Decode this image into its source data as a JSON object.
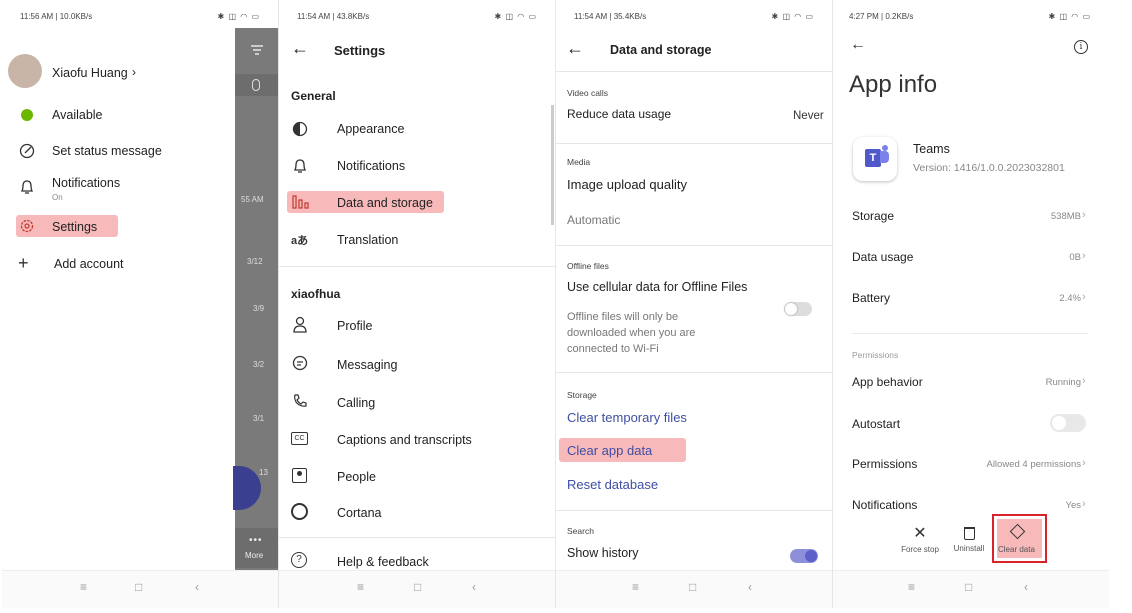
{
  "panel1": {
    "status_time": "11:56 AM | 10.0KB/s",
    "status_icons": "✱ ◫ ◠ ▭",
    "user_name": "Xiaofu Huang",
    "menu": [
      {
        "label": "Available",
        "sub": ""
      },
      {
        "label": "Set status message",
        "sub": ""
      },
      {
        "label": "Notifications",
        "sub": "On"
      },
      {
        "label": "Settings",
        "sub": ""
      },
      {
        "label": "Add account",
        "sub": ""
      }
    ],
    "overlay_times": [
      "55 AM",
      "3/12",
      "3/9",
      "3/2",
      "3/1",
      "13"
    ],
    "overlay_more": "More"
  },
  "panel2": {
    "status_time": "11:54 AM | 43.8KB/s",
    "status_icons": "✱ ◫ ◠ ▭",
    "title": "Settings",
    "section_general": "General",
    "general_items": [
      "Appearance",
      "Notifications",
      "Data and storage",
      "Translation"
    ],
    "section_account": "xiaofhua",
    "account_items": [
      "Profile",
      "Messaging",
      "Calling",
      "Captions and transcripts",
      "People",
      "Cortana",
      "Help & feedback"
    ]
  },
  "panel3": {
    "status_time": "11:54 AM | 35.4KB/s",
    "status_icons": "✱ ◫ ◠ ▭",
    "title": "Data and storage",
    "video_calls_header": "Video calls",
    "reduce_data_label": "Reduce data usage",
    "reduce_data_value": "Never",
    "media_header": "Media",
    "image_quality_label": "Image upload quality",
    "image_quality_value": "Automatic",
    "offline_header": "Offline files",
    "offline_label": "Use cellular data for Offline Files",
    "offline_desc": "Offline files will only be downloaded when you are connected to Wi-Fi",
    "storage_header": "Storage",
    "clear_temp": "Clear temporary files",
    "clear_app": "Clear app data",
    "reset_db": "Reset database",
    "search_header": "Search",
    "show_history": "Show history"
  },
  "panel4": {
    "status_time": "4:27 PM | 0.2KB/s",
    "status_icons": "✱ ◫ ◠ ▭",
    "title": "App info",
    "app_name": "Teams",
    "app_version": "Version: 1416/1.0.0.2023032801",
    "rows_top": [
      {
        "label": "Storage",
        "value": "538MB"
      },
      {
        "label": "Data usage",
        "value": "0B"
      },
      {
        "label": "Battery",
        "value": "2.4%"
      }
    ],
    "permissions_header": "Permissions",
    "app_behavior_label": "App behavior",
    "app_behavior_value": "Running",
    "autostart_label": "Autostart",
    "permissions_label": "Permissions",
    "permissions_value": "Allowed 4 permissions",
    "notifications_label": "Notifications",
    "notifications_value": "Yes",
    "actions": [
      "Force stop",
      "Uninstall",
      "Clear data"
    ]
  },
  "colors": {
    "highlight": "#f7b9ba",
    "link": "#3e4ea4",
    "toggle_on": "#5b5fc7",
    "red_box": "#d9222a"
  }
}
